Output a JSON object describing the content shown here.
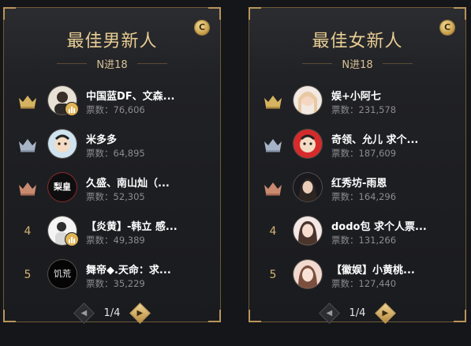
{
  "boards": [
    {
      "title": "最佳男新人",
      "subtitle": "N进18",
      "coin_icon": "C",
      "pager": {
        "text": "1/4",
        "prev": "◀",
        "next": "▶"
      },
      "entries": [
        {
          "rank": "1",
          "name": "中国蓝DF、文森...",
          "votes": "票数：76,606",
          "crown_color": "#d6b360"
        },
        {
          "rank": "2",
          "name": "米多多",
          "votes": "票数：64,895",
          "crown_color": "#a7b3c6"
        },
        {
          "rank": "3",
          "name": "久盛、南山灿（...",
          "votes": "票数：52,305",
          "crown_color": "#c98a70",
          "avatar_text": "梨皇"
        },
        {
          "rank": "4",
          "name": "【炎黄】-韩立 感...",
          "votes": "票数：49,389"
        },
        {
          "rank": "5",
          "name": "舞帝◆.天命：求...",
          "votes": "票数：35,229",
          "avatar_text": "饥荒"
        }
      ]
    },
    {
      "title": "最佳女新人",
      "subtitle": "N进18",
      "coin_icon": "C",
      "pager": {
        "text": "1/4",
        "prev": "◀",
        "next": "▶"
      },
      "entries": [
        {
          "rank": "1",
          "name": "娱+小阿七",
          "votes": "票数：231,578",
          "crown_color": "#d6b360"
        },
        {
          "rank": "2",
          "name": "奇领、允儿 求个...",
          "votes": "票数：187,609",
          "crown_color": "#a7b3c6"
        },
        {
          "rank": "3",
          "name": "红秀坊-雨恩",
          "votes": "票数：164,296",
          "crown_color": "#c98a70"
        },
        {
          "rank": "4",
          "name": "dodo包 求个人票...",
          "votes": "票数：131,266"
        },
        {
          "rank": "5",
          "name": "【徽娱】小黄桃...",
          "votes": "票数：127,440"
        }
      ]
    }
  ]
}
